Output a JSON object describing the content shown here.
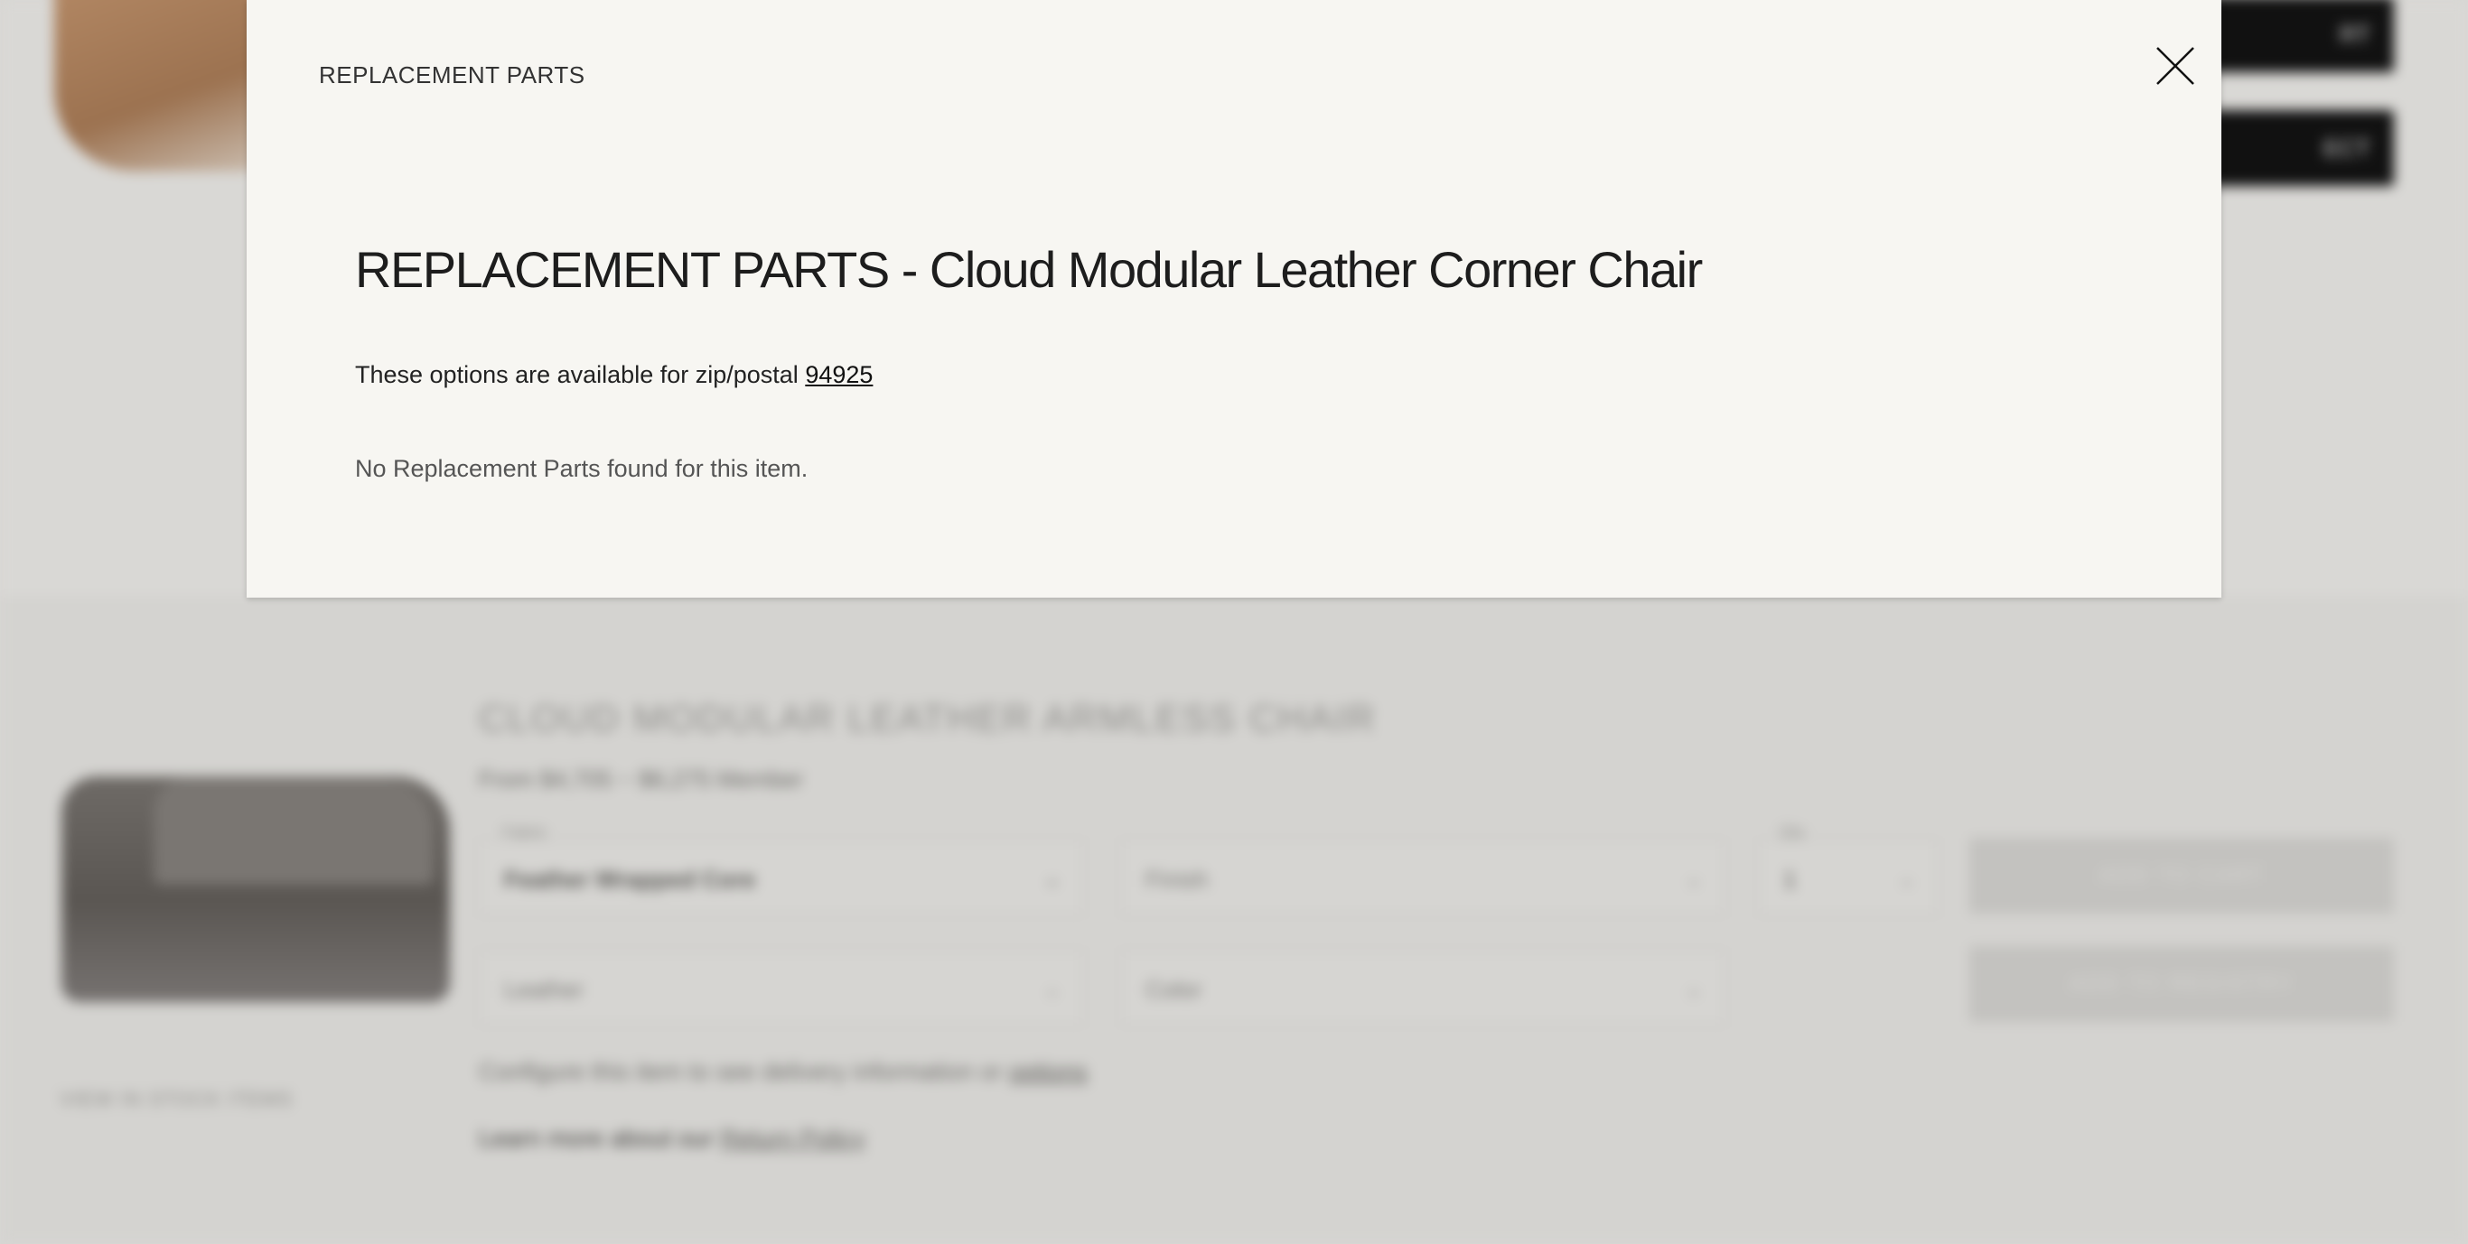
{
  "modal": {
    "header": "REPLACEMENT PARTS",
    "title": "REPLACEMENT PARTS - Cloud Modular Leather Corner Chair",
    "availability_prefix": "These options are available for zip/postal",
    "zip": "94925",
    "empty_message": "No Replacement Parts found for this item.",
    "close_icon": "close-icon"
  },
  "background": {
    "top_buttons": [
      "RT",
      "ECT"
    ],
    "product_title": "CLOUD MODULAR LEATHER ARMLESS CHAIR",
    "price": "From $4,705 ~ $6,275 Member",
    "image_caption": "VIEW IN STOCK ITEMS",
    "fields": {
      "fabric_label": "Fabric",
      "fabric_value": "Feather Wrapped Core",
      "finish_value": "Finish",
      "qty_label": "Qty",
      "qty_value": "1",
      "leather_value": "Leather",
      "color_value": "Color"
    },
    "add_to_cart": "ADD TO CART",
    "add_to_registry": "ADD TO REGISTRY",
    "configure_text": "Configure this item to see delivery information or",
    "configure_link": "options",
    "learn_text": "Learn more about our",
    "learn_link": "Return Policy"
  }
}
